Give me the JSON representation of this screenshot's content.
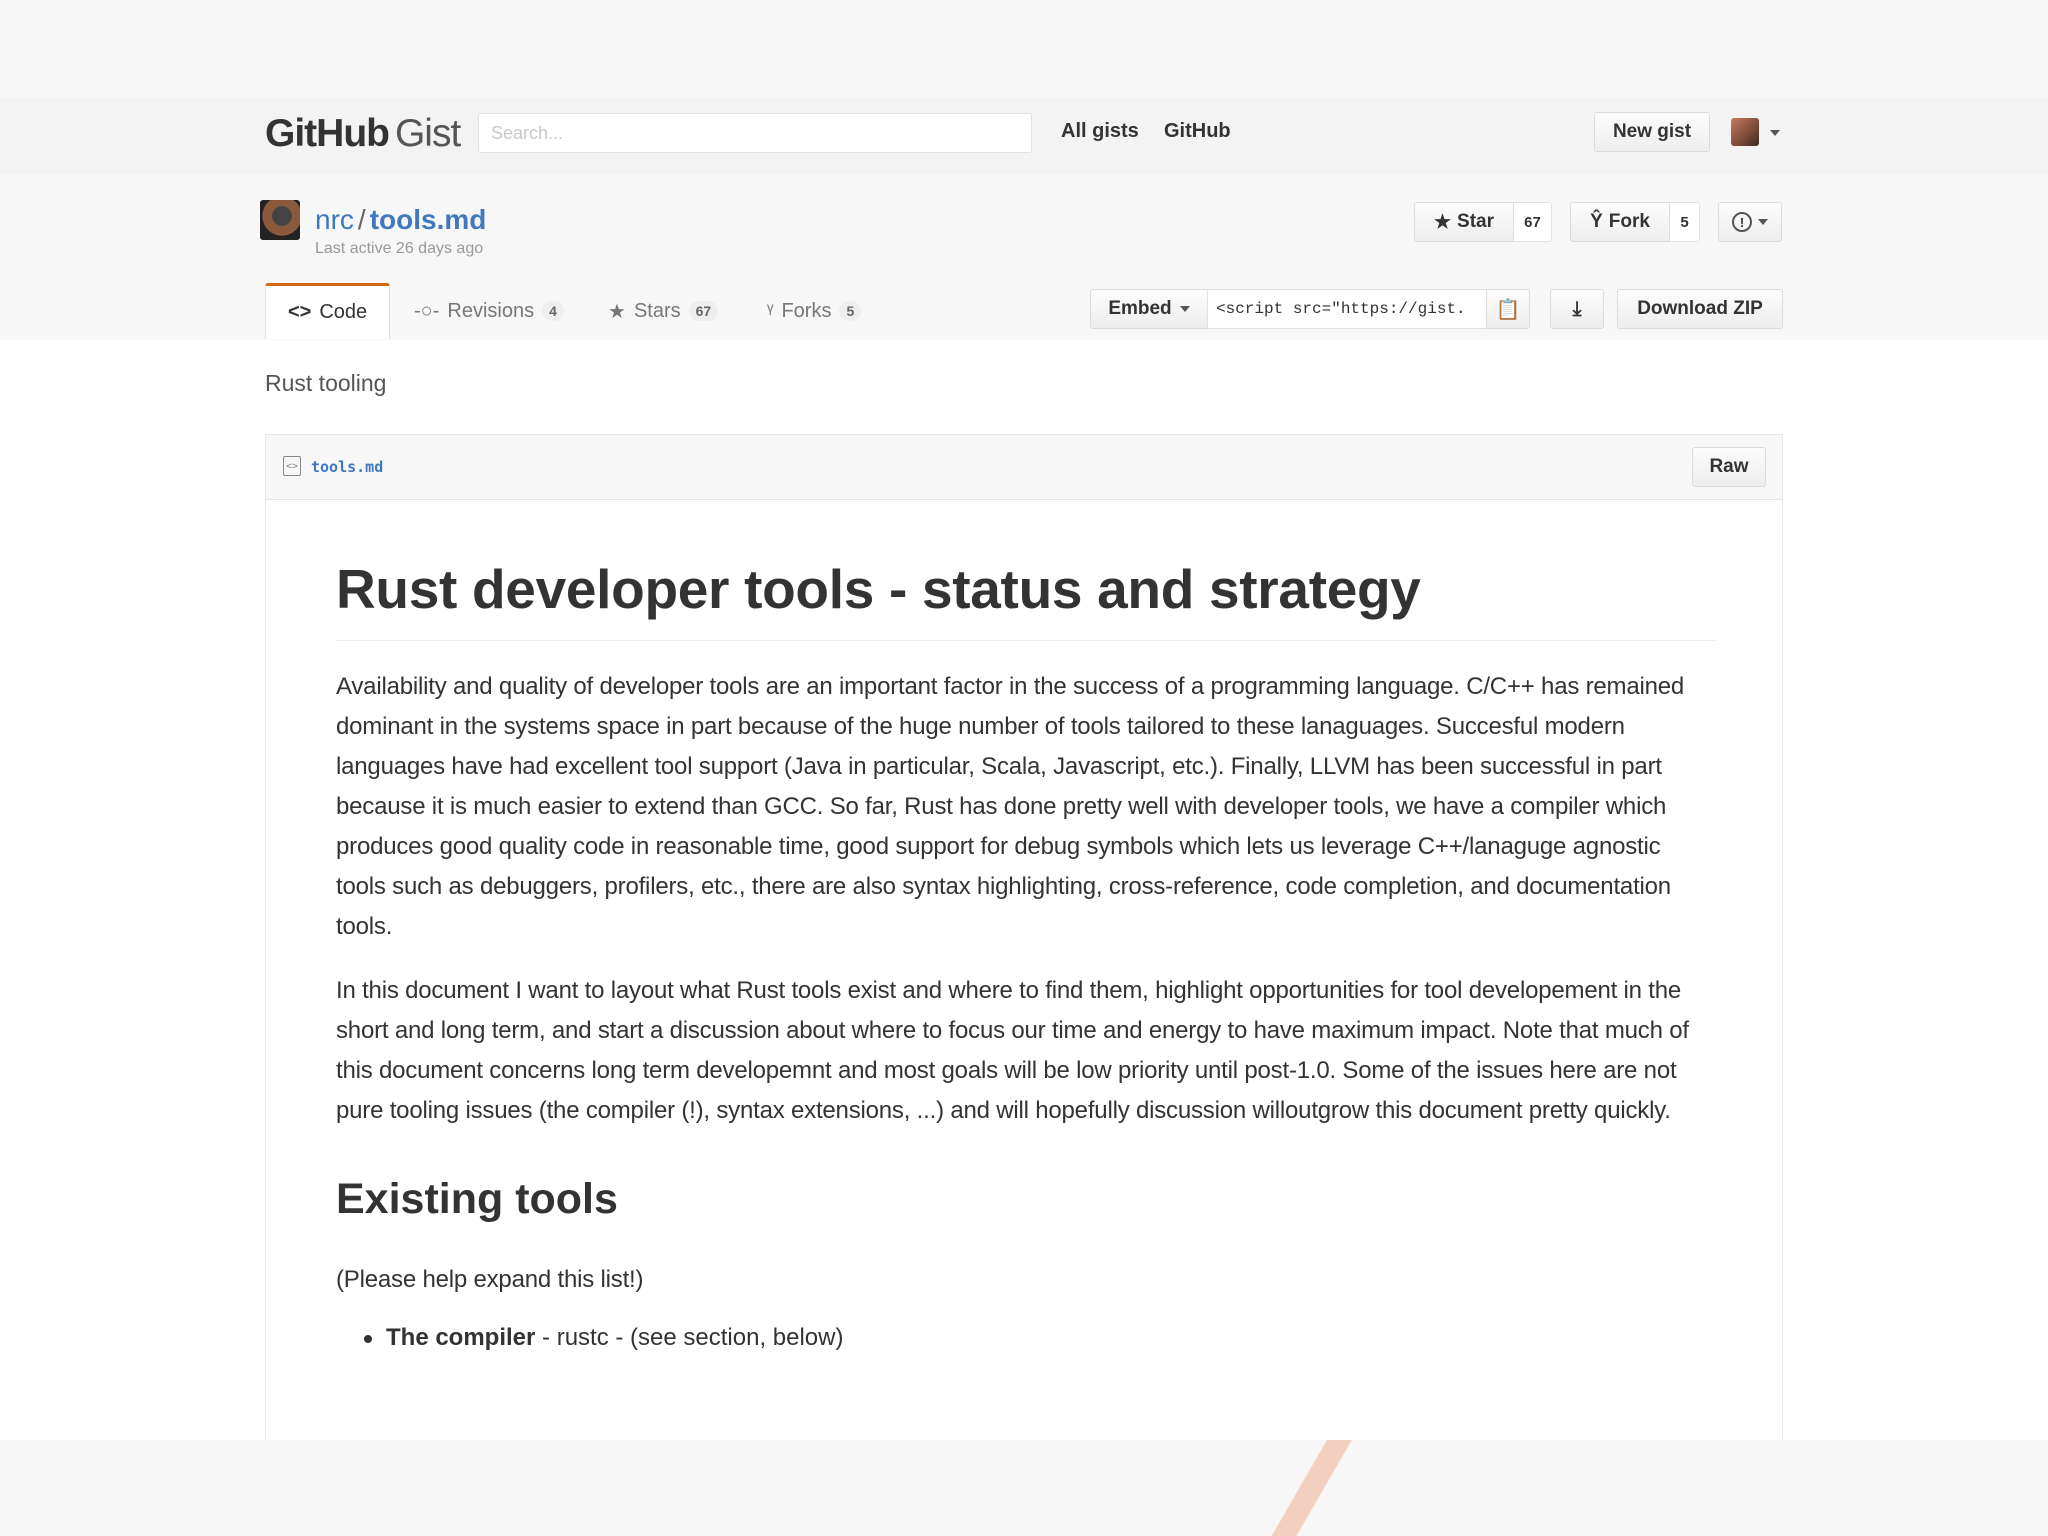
{
  "header": {
    "logo_bold": "GitHub",
    "logo_light": "Gist",
    "search_placeholder": "Search...",
    "nav": {
      "all_gists": "All gists",
      "github": "GitHub"
    },
    "new_gist": "New gist"
  },
  "gist": {
    "owner": "nrc",
    "separator": "/",
    "filename": "tools.md",
    "last_active": "Last active 26 days ago",
    "star_label": "Star",
    "star_count": "67",
    "fork_label": "Fork",
    "fork_count": "5"
  },
  "tabs": [
    {
      "label": "Code",
      "count": ""
    },
    {
      "label": "Revisions",
      "count": "4"
    },
    {
      "label": "Stars",
      "count": "67"
    },
    {
      "label": "Forks",
      "count": "5"
    }
  ],
  "embed": {
    "button": "Embed",
    "value": "<script src=\"https://gist.",
    "download_zip": "Download ZIP"
  },
  "description": "Rust tooling",
  "file": {
    "name": "tools.md",
    "raw": "Raw"
  },
  "article": {
    "title": "Rust developer tools - status and strategy",
    "p1": "Availability and quality of developer tools are an important factor in the success of a programming language. C/C++ has remained dominant in the systems space in part because of the huge number of tools tailored to these lanaguages. Succesful modern languages have had excellent tool support (Java in particular, Scala, Javascript, etc.). Finally, LLVM has been successful in part because it is much easier to extend than GCC. So far, Rust has done pretty well with developer tools, we have a compiler which produces good quality code in reasonable time, good support for debug symbols which lets us leverage C++/lanaguge agnostic tools such as debuggers, profilers, etc., there are also syntax highlighting, cross-reference, code completion, and documentation tools.",
    "p2": "In this document I want to layout what Rust tools exist and where to find them, highlight opportunities for tool developement in the short and long term, and start a discussion about where to focus our time and energy to have maximum impact. Note that much of this document concerns long term developemnt and most goals will be low priority until post-1.0. Some of the issues here are not pure tooling issues (the compiler (!), syntax extensions, ...) and will hopefully discussion willoutgrow this document pretty quickly.",
    "h2": "Existing tools",
    "p3": "(Please help expand this list!)",
    "list": [
      {
        "bold": "The compiler",
        "rest": " - rustc - (see section, below)"
      }
    ]
  }
}
